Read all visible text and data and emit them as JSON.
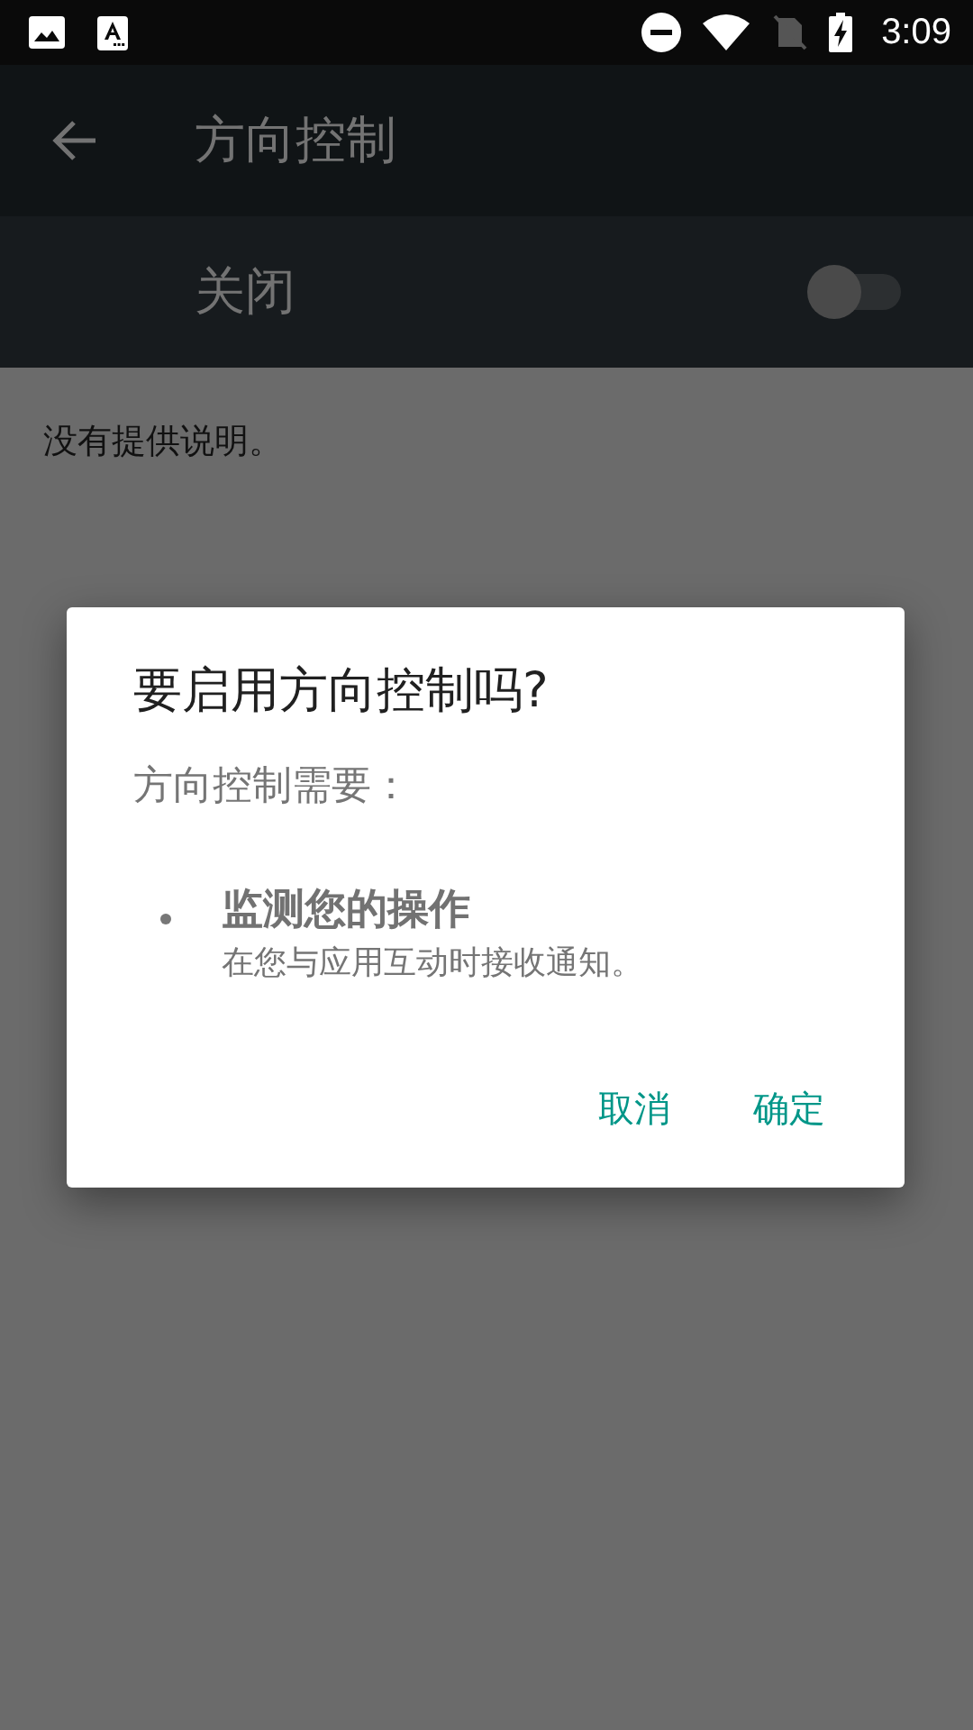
{
  "status_bar": {
    "time": "3:09"
  },
  "app_bar": {
    "title": "方向控制"
  },
  "master_switch": {
    "label": "关闭",
    "on": false
  },
  "description": "没有提供说明。",
  "dialog": {
    "title": "要启用方向控制吗?",
    "subtitle": "方向控制需要：",
    "permissions": [
      {
        "title": "监测您的操作",
        "detail": "在您与应用互动时接收通知。"
      }
    ],
    "buttons": [
      {
        "label": "取消"
      },
      {
        "label": "确定"
      }
    ]
  }
}
